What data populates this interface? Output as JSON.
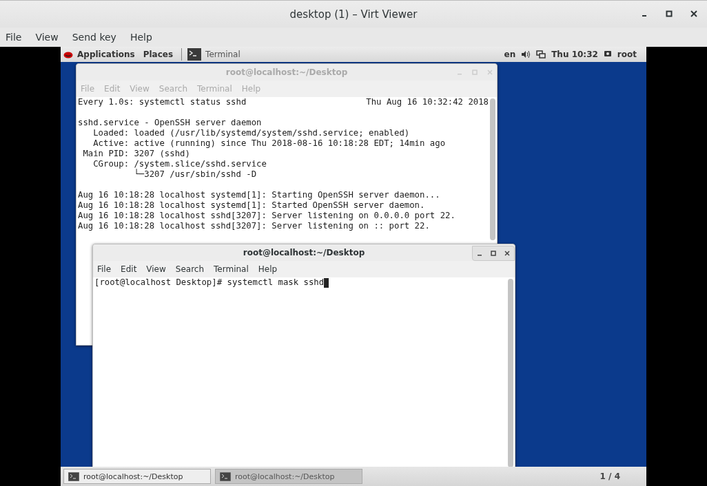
{
  "window": {
    "title": "desktop (1) – Virt Viewer"
  },
  "menu": [
    "File",
    "View",
    "Send key",
    "Help"
  ],
  "top_panel": {
    "applications": "Applications",
    "places": "Places",
    "active_app": "Terminal",
    "language": "en",
    "clock": "Thu 10:32",
    "user": "root"
  },
  "windows": [
    {
      "title": "root@localhost:~/Desktop",
      "active": false,
      "menu": [
        "File",
        "Edit",
        "View",
        "Search",
        "Terminal",
        "Help"
      ],
      "header": {
        "command": "Every 1.0s: systemctl status sshd",
        "time": "Thu Aug 16 10:32:42 2018"
      },
      "blocks": [
        [
          "sshd.service - OpenSSH server daemon",
          "   Loaded: loaded (/usr/lib/systemd/system/sshd.service; enabled)",
          "   Active: active (running) since Thu 2018-08-16 10:18:28 EDT; 14min ago",
          " Main PID: 3207 (sshd)",
          "   CGroup: /system.slice/sshd.service",
          "           └─3207 /usr/sbin/sshd -D"
        ],
        [
          "Aug 16 10:18:28 localhost systemd[1]: Starting OpenSSH server daemon...",
          "Aug 16 10:18:28 localhost systemd[1]: Started OpenSSH server daemon.",
          "Aug 16 10:18:28 localhost sshd[3207]: Server listening on 0.0.0.0 port 22.",
          "Aug 16 10:18:28 localhost sshd[3207]: Server listening on :: port 22."
        ]
      ]
    },
    {
      "title": "root@localhost:~/Desktop",
      "active": true,
      "menu": [
        "File",
        "Edit",
        "View",
        "Search",
        "Terminal",
        "Help"
      ],
      "prompt": "[root@localhost Desktop]# ",
      "command": "systemctl mask sshd",
      "cursor": true
    }
  ],
  "taskbar": {
    "items": [
      {
        "label": "root@localhost:~/Desktop",
        "selected": false
      },
      {
        "label": "root@localhost:~/Desktop",
        "selected": true
      }
    ],
    "workspace": "1 / 4"
  }
}
